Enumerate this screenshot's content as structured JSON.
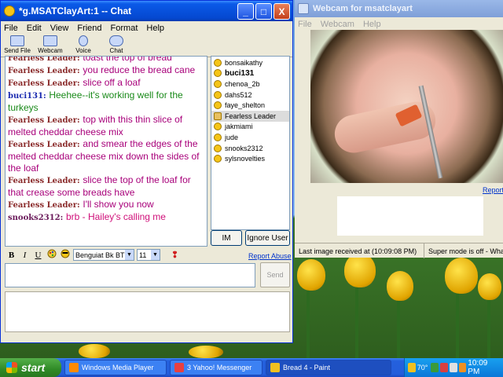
{
  "chat_window": {
    "title": "*g.MSATClayArt:1 -- Chat",
    "title_buttons": [
      "_",
      "□",
      "X"
    ],
    "menu": [
      "File",
      "Edit",
      "View",
      "Friend",
      "Format",
      "Help"
    ],
    "toolbar": [
      "Send File",
      "Webcam",
      "Voice",
      "Chat"
    ],
    "messages": [
      {
        "nick": "Fearless Leader:",
        "text": "toast the top of bread",
        "style": "fl"
      },
      {
        "nick": "Fearless Leader:",
        "text": "you reduce the bread cane",
        "style": "fl"
      },
      {
        "nick": "Fearless Leader:",
        "text": "slice off a loaf",
        "style": "fl"
      },
      {
        "nick": "buci131:",
        "text": "Heehee--it's working well for the turkeys",
        "style": "buci"
      },
      {
        "nick": "Fearless Leader:",
        "text": "top with this thin slice of melted cheddar cheese mix",
        "style": "fl"
      },
      {
        "nick": "Fearless Leader:",
        "text": "and smear the edges of the melted cheddar cheese mix down the sides of the loaf",
        "style": "fl"
      },
      {
        "nick": "Fearless Leader:",
        "text": "slice the top of the loaf for that crease some breads have",
        "style": "fl"
      },
      {
        "nick": "Fearless Leader:",
        "text": "I'll show you now",
        "style": "fl"
      },
      {
        "nick": "snooks2312:",
        "text": "brb - Hailey's calling me",
        "style": "snook"
      }
    ],
    "users": [
      {
        "name": "bonsaikathy"
      },
      {
        "name": "buci131",
        "bold": true
      },
      {
        "name": "chenoa_2b"
      },
      {
        "name": "dahs512"
      },
      {
        "name": "faye_shelton"
      },
      {
        "name": "Fearless Leader",
        "selected": true
      },
      {
        "name": "jakmiami"
      },
      {
        "name": "jude"
      },
      {
        "name": "snooks2312"
      },
      {
        "name": "sylsnovelties"
      }
    ],
    "im_label": "IM",
    "ignore_label": "Ignore User",
    "format": {
      "bold": "B",
      "italic": "I",
      "underline": "U",
      "font": "Benguiat Bk BT",
      "size": "11"
    },
    "report_abuse": "Report Abuse",
    "send_label": "Send"
  },
  "webcam_window": {
    "title": "Webcam for msatclayart",
    "menu": [
      "File",
      "Webcam",
      "Help"
    ],
    "report_link": "Report",
    "status_last": "Last image received at (10:09:08 PM)",
    "status_super": "Super mode is off - What's"
  },
  "taskbar": {
    "start_label": "start",
    "tasks": [
      {
        "label": "Windows Media Player",
        "color": "#ff8a00"
      },
      {
        "label": "3 Yahoo! Messenger",
        "color": "#e84040"
      },
      {
        "label": "Bread 4 - Paint",
        "color": "#f0c020",
        "active": true
      }
    ],
    "tray_temp": "70°",
    "clock": "10:09 PM"
  },
  "colors": {
    "xp_blue": "#0548d0",
    "fearless_nick": "#8a2a2a",
    "fearless_text": "#a8007a",
    "buci_nick": "#1a2ab0",
    "buci_text": "#1a8a1a",
    "snooks_text": "#d0107a"
  }
}
